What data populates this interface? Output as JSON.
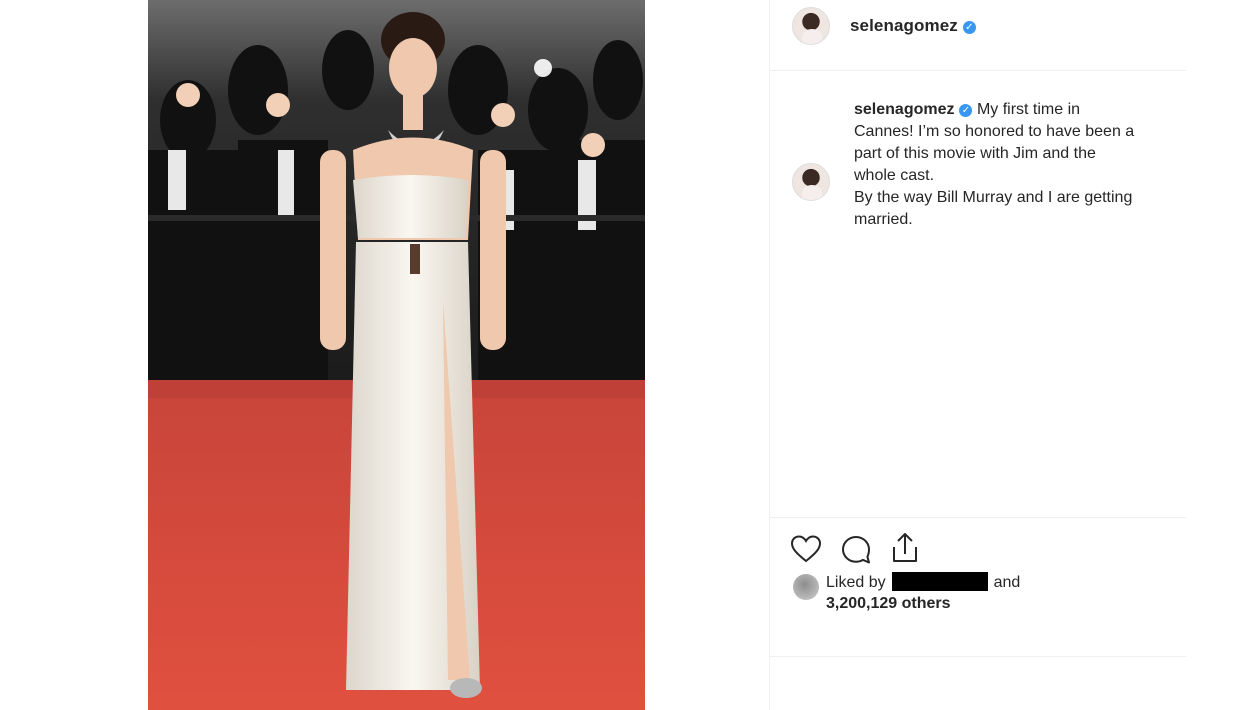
{
  "post": {
    "username": "selenagomez",
    "verified_mark": "✓",
    "caption_lines": [
      "My first time in",
      "Cannes! I’m so honored to have been a",
      "part of this movie with Jim and the",
      "whole cast.",
      "By the way Bill Murray and I are getting",
      "married."
    ],
    "likes_prefix": "Liked by",
    "likes_and": "and",
    "likes_count": "3,200,129 others"
  },
  "icons": {
    "like": "heart-icon",
    "comment": "comment-bubble-icon",
    "share": "share-icon",
    "verified": "verified-badge-icon"
  },
  "colors": {
    "verified": "#3897f0",
    "carpet": "#d9473c",
    "text": "#262626",
    "divider": "#efefef"
  }
}
